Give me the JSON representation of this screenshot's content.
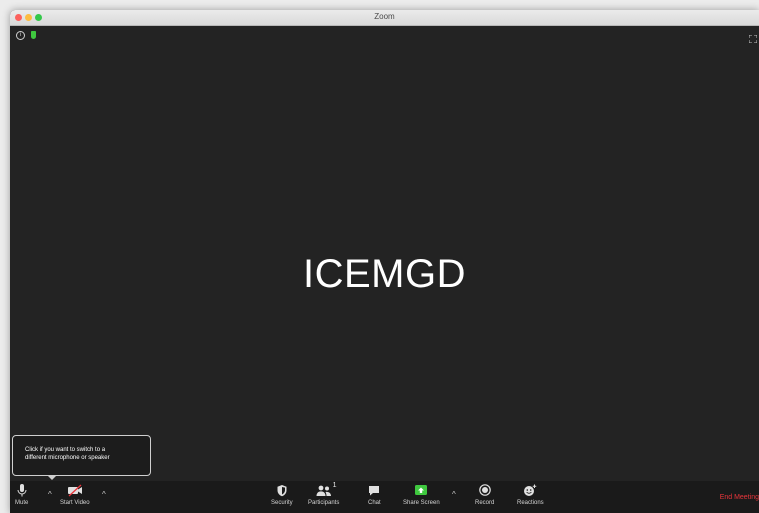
{
  "window": {
    "title": "Zoom"
  },
  "meeting": {
    "display_name": "ICEMGD"
  },
  "tooltip": {
    "line1": "Click if you want to switch to a",
    "line2": "different microphone or speaker"
  },
  "toolbar": {
    "mute_label": "Mute",
    "start_video_label": "Start Video",
    "security_label": "Security",
    "participants_label": "Participants",
    "participants_count": "1",
    "chat_label": "Chat",
    "share_screen_label": "Share Screen",
    "record_label": "Record",
    "reactions_label": "Reactions",
    "end_meeting_label": "End Meeting",
    "caret": "^"
  },
  "colors": {
    "meeting_background": "#232323",
    "toolbar_background": "#1a1a1a",
    "end_meeting": "#e8353b",
    "share_screen": "#3fc83f"
  },
  "icons": {
    "title_bar": [
      "close-icon",
      "minimize-icon",
      "maximize-icon"
    ],
    "top_left": [
      "info-icon",
      "shield-icon"
    ],
    "top_right": "fullscreen-icon",
    "toolbar": [
      "microphone-icon",
      "video-off-icon",
      "security-shield-icon",
      "participants-icon",
      "chat-bubble-icon",
      "share-screen-icon",
      "record-icon",
      "reactions-icon"
    ]
  }
}
